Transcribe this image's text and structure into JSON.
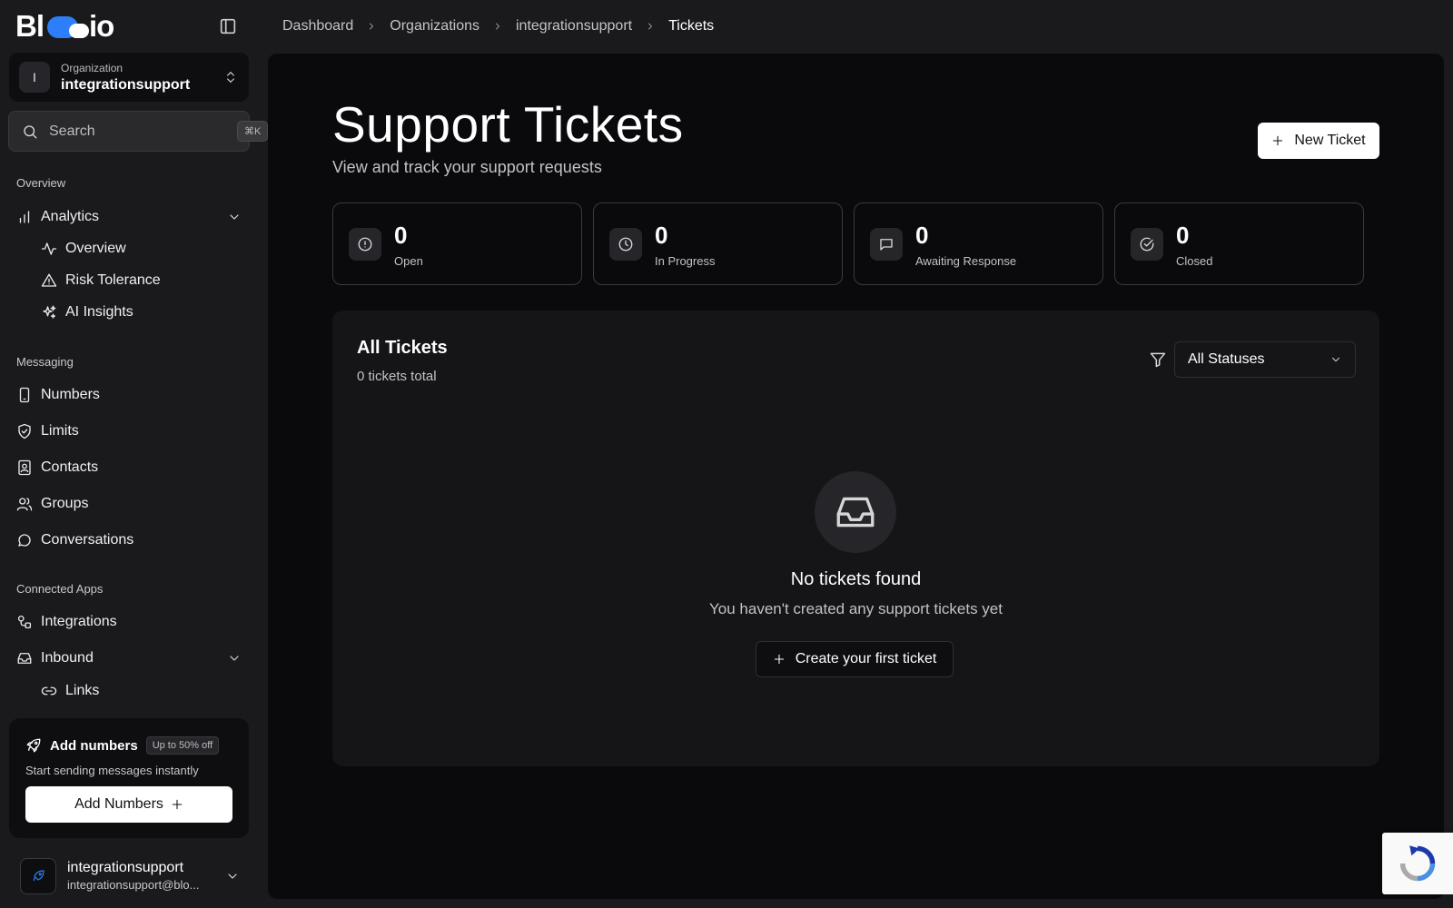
{
  "brand": {
    "logo_left": "Bl",
    "logo_right": "io",
    "accent": "#2d7ff9"
  },
  "org": {
    "label": "Organization",
    "name": "integrationsupport",
    "initial": "I"
  },
  "search": {
    "placeholder": "Search",
    "shortcut": "⌘K"
  },
  "sidebar": {
    "sections": {
      "overview": "Overview",
      "messaging": "Messaging",
      "connected_apps": "Connected Apps"
    },
    "analytics": {
      "label": "Analytics",
      "children": {
        "overview": "Overview",
        "risk_tolerance": "Risk Tolerance",
        "ai_insights": "AI Insights"
      }
    },
    "messaging_items": {
      "numbers": "Numbers",
      "limits": "Limits",
      "contacts": "Contacts",
      "groups": "Groups",
      "conversations": "Conversations"
    },
    "apps_items": {
      "integrations": "Integrations",
      "inbound": "Inbound",
      "links": "Links"
    }
  },
  "promo": {
    "title": "Add numbers",
    "badge": "Up to 50% off",
    "subtitle": "Start sending messages instantly",
    "button": "Add Numbers"
  },
  "user": {
    "name": "integrationsupport",
    "email": "integrationsupport@blo..."
  },
  "breadcrumb": [
    "Dashboard",
    "Organizations",
    "integrationsupport",
    "Tickets"
  ],
  "page": {
    "title": "Support Tickets",
    "subtitle": "View and track your support requests",
    "new_ticket": "New Ticket"
  },
  "stats": [
    {
      "value": "0",
      "label": "Open",
      "icon": "alert-circle-icon"
    },
    {
      "value": "0",
      "label": "In Progress",
      "icon": "clock-icon"
    },
    {
      "value": "0",
      "label": "Awaiting Response",
      "icon": "message-square-icon"
    },
    {
      "value": "0",
      "label": "Closed",
      "icon": "check-circle-icon"
    }
  ],
  "tickets": {
    "title": "All Tickets",
    "count_text": "0 tickets total",
    "filter": {
      "selected": "All Statuses"
    },
    "empty": {
      "title": "No tickets found",
      "subtitle": "You haven't created any support tickets yet",
      "button": "Create your first ticket"
    }
  }
}
